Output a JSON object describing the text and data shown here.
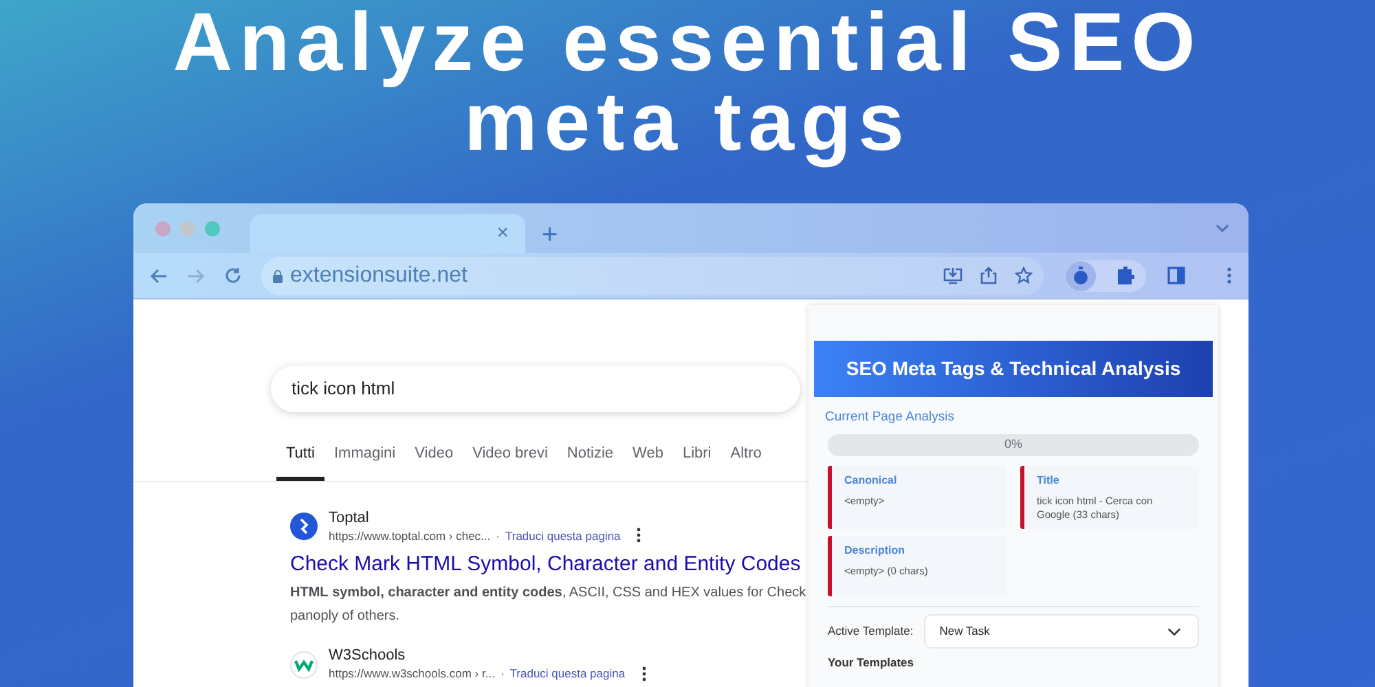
{
  "headline": [
    "Analyze essential SEO",
    "meta tags"
  ],
  "browser": {
    "tab_close": "×",
    "new_tab": "+",
    "url": "extensionsuite.net"
  },
  "search": {
    "query": "tick icon html",
    "tabs": [
      {
        "label": "Tutti",
        "selected": true
      },
      {
        "label": "Immagini",
        "selected": false
      },
      {
        "label": "Video",
        "selected": false
      },
      {
        "label": "Video brevi",
        "selected": false
      },
      {
        "label": "Notizie",
        "selected": false
      },
      {
        "label": "Web",
        "selected": false
      },
      {
        "label": "Libri",
        "selected": false
      },
      {
        "label": "Altro",
        "selected": false
      }
    ]
  },
  "results": [
    {
      "site": "Toptal",
      "url": "https://www.toptal.com › chec...",
      "separator": "·",
      "translate": "Traduci questa pagina",
      "title": "Check Mark HTML Symbol, Character and Entity Codes",
      "snippet": [
        "**HTML** **symbol, character and entity codes**, ASCII, CSS and HEX values for Check",
        "panoply of others."
      ]
    },
    {
      "site": "W3Schools",
      "url": "https://www.w3schools.com › r...",
      "separator": "·",
      "translate": "Traduci questa pagina"
    }
  ],
  "extension": {
    "title": "SEO Meta Tags & Technical Analysis",
    "section": "Current Page Analysis",
    "progress": {
      "level": 0,
      "label": "0%"
    },
    "cards": [
      {
        "label": "Canonical",
        "value": "<empty>"
      },
      {
        "label": "Title",
        "value": "tick icon html - Cerca con Google (33 chars)"
      },
      {
        "label": "Description",
        "value": "<empty> (0 chars)"
      }
    ],
    "template": {
      "label": "Active Template:",
      "value": "New Task"
    },
    "templates_heading": "Your Templates"
  }
}
